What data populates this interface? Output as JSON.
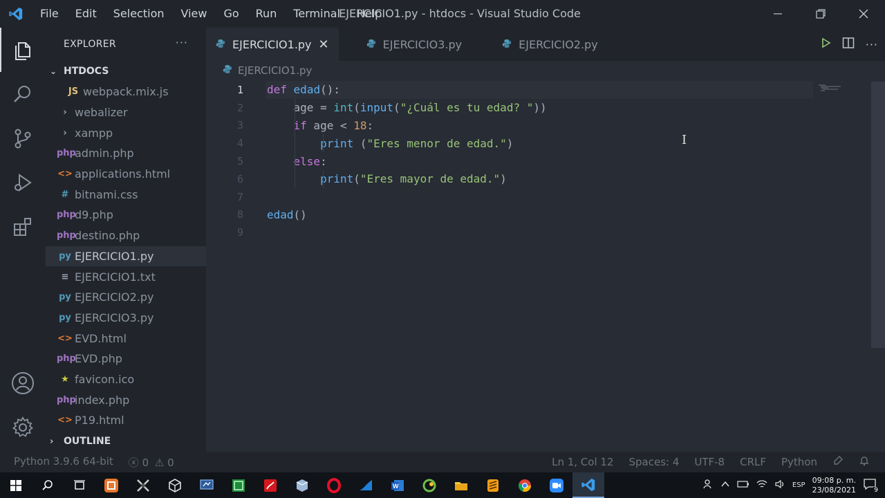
{
  "window": {
    "title": "EJERCICIO1.py - htdocs - Visual Studio Code",
    "menu": [
      "File",
      "Edit",
      "Selection",
      "View",
      "Go",
      "Run",
      "Terminal",
      "Help"
    ]
  },
  "sidebar": {
    "header": "EXPLORER",
    "more": "···",
    "folder": "HTDOCS",
    "items": [
      {
        "icon": "JS",
        "label": "webpack.mix.js",
        "color": "#e5c07b",
        "indent": 1
      },
      {
        "icon": "›",
        "label": "webalizer",
        "color": "#9da5b4",
        "indent": 0
      },
      {
        "icon": "›",
        "label": "xampp",
        "color": "#9da5b4",
        "indent": 0
      },
      {
        "icon": "php",
        "label": "admin.php",
        "color": "#a074c4",
        "indent": 0
      },
      {
        "icon": "<>",
        "label": "applications.html",
        "color": "#e37933",
        "indent": 0
      },
      {
        "icon": "#",
        "label": "bitnami.css",
        "color": "#519aba",
        "indent": 0
      },
      {
        "icon": "php",
        "label": "d9.php",
        "color": "#a074c4",
        "indent": 0
      },
      {
        "icon": "php",
        "label": "destino.php",
        "color": "#a074c4",
        "indent": 0
      },
      {
        "icon": "py",
        "label": "EJERCICIO1.py",
        "color": "#519aba",
        "indent": 0
      },
      {
        "icon": "≡",
        "label": "EJERCICIO1.txt",
        "color": "#9da5b4",
        "indent": 0
      },
      {
        "icon": "py",
        "label": "EJERCICIO2.py",
        "color": "#519aba",
        "indent": 0
      },
      {
        "icon": "py",
        "label": "EJERCICIO3.py",
        "color": "#519aba",
        "indent": 0
      },
      {
        "icon": "<>",
        "label": "EVD.html",
        "color": "#e37933",
        "indent": 0
      },
      {
        "icon": "php",
        "label": "EVD.php",
        "color": "#a074c4",
        "indent": 0
      },
      {
        "icon": "★",
        "label": "favicon.ico",
        "color": "#cbcb41",
        "indent": 0
      },
      {
        "icon": "php",
        "label": "index.php",
        "color": "#a074c4",
        "indent": 0
      },
      {
        "icon": "<>",
        "label": "P19.html",
        "color": "#e37933",
        "indent": 0
      }
    ],
    "outline": "OUTLINE"
  },
  "tabs": [
    {
      "label": "EJERCICIO1.py",
      "active": true
    },
    {
      "label": "EJERCICIO3.py",
      "active": false
    },
    {
      "label": "EJERCICIO2.py",
      "active": false
    }
  ],
  "breadcrumb": "EJERCICIO1.py",
  "code_lines": [
    {
      "n": "1",
      "html": "<span class=\"kw\">def</span> <span class=\"fn\">edad</span>():"
    },
    {
      "n": "2",
      "html": "    age = <span class=\"bi\">int</span>(<span class=\"fn\">input</span>(<span class=\"str\">\"¿Cuál es tu edad? \"</span>))"
    },
    {
      "n": "3",
      "html": "    <span class=\"kw\">if</span> age &lt; <span class=\"num\">18</span>:"
    },
    {
      "n": "4",
      "html": "        <span class=\"fn\">print</span> (<span class=\"str\">\"Eres menor de edad.\"</span>)"
    },
    {
      "n": "5",
      "html": "    <span class=\"kw\">else</span>:"
    },
    {
      "n": "6",
      "html": "        <span class=\"fn\">print</span>(<span class=\"str\">\"Eres mayor de edad.\"</span>)"
    },
    {
      "n": "7",
      "html": ""
    },
    {
      "n": "8",
      "html": "<span class=\"fn\">edad</span>()"
    },
    {
      "n": "9",
      "html": ""
    }
  ],
  "status": {
    "python": "Python 3.9.6 64-bit",
    "errors": "0",
    "warnings": "0",
    "position": "Ln 1, Col 12",
    "spaces": "Spaces: 4",
    "encoding": "UTF-8",
    "eol": "CRLF",
    "language": "Python"
  },
  "taskbar": {
    "lang": "ESP",
    "time": "09:08 p. m.",
    "date": "23/08/2021",
    "notifications": "9"
  },
  "colors": {
    "accent": "#61afef",
    "keyword": "#c678dd",
    "string": "#98c379",
    "number": "#d19a66"
  }
}
